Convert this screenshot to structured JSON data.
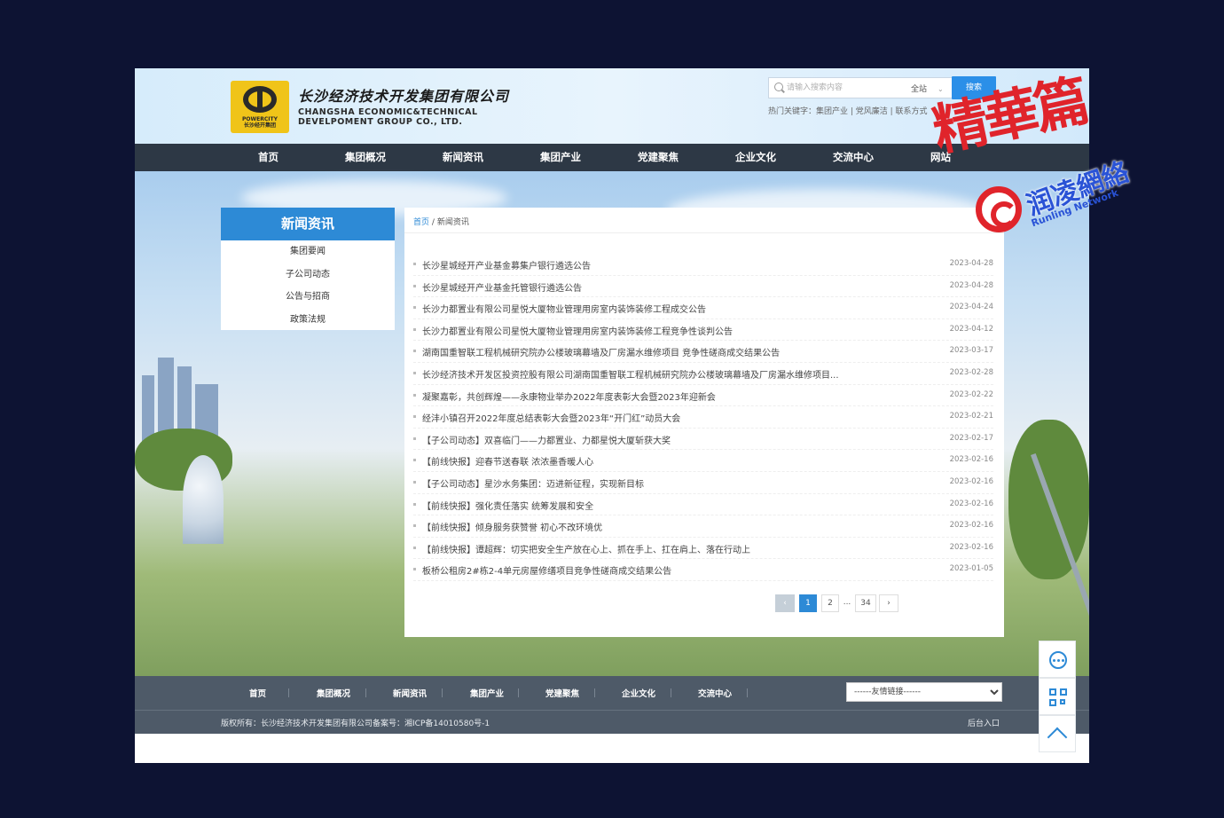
{
  "header": {
    "company_cn": "长沙经济技术开发集团有限公司",
    "company_en_line1": "CHANGSHA ECONOMIC&TECHNICAL",
    "company_en_line2": "DEVELPOMENT GROUP CO., LTD.",
    "logo_text_line1": "POWERCITY",
    "logo_text_line2": "长沙经开集团",
    "search": {
      "placeholder": "请输入搜索内容",
      "scope": "全站",
      "button": "搜索"
    },
    "hot_links": "热门关键字：集团产业 | 党风廉洁 | 联系方式"
  },
  "nav": [
    "首页",
    "集团概况",
    "新闻资讯",
    "集团产业",
    "党建聚焦",
    "企业文化",
    "交流中心",
    "网站"
  ],
  "sidebar": {
    "title": "新闻资讯",
    "items": [
      "集团要闻",
      "子公司动态",
      "公告与招商",
      "政策法规"
    ]
  },
  "breadcrumb": {
    "home": "首页",
    "separator": "/",
    "current": "新闻资讯"
  },
  "news": [
    {
      "title": "长沙星城经开产业基金募集户银行遴选公告",
      "date": "2023-04-28"
    },
    {
      "title": "长沙星城经开产业基金托管银行遴选公告",
      "date": "2023-04-28"
    },
    {
      "title": "长沙力都置业有限公司星悦大厦物业管理用房室内装饰装修工程成交公告",
      "date": "2023-04-24"
    },
    {
      "title": "长沙力都置业有限公司星悦大厦物业管理用房室内装饰装修工程竞争性谈判公告",
      "date": "2023-04-12"
    },
    {
      "title": "湖南国重智联工程机械研究院办公楼玻璃幕墙及厂房漏水维修项目 竞争性磋商成交结果公告",
      "date": "2023-03-17"
    },
    {
      "title": "长沙经济技术开发区投资控股有限公司湖南国重智联工程机械研究院办公楼玻璃幕墙及厂房漏水维修项目...",
      "date": "2023-02-28"
    },
    {
      "title": "凝聚嘉彰，共创辉煌——永康物业举办2022年度表彰大会暨2023年迎新会",
      "date": "2023-02-22"
    },
    {
      "title": "经沣小镇召开2022年度总结表彰大会暨2023年“开门红”动员大会",
      "date": "2023-02-21"
    },
    {
      "title": "【子公司动态】双喜临门——力都置业、力都星悦大厦斩获大奖",
      "date": "2023-02-17"
    },
    {
      "title": "【前线快报】迎春节送春联 浓浓墨香暖人心",
      "date": "2023-02-16"
    },
    {
      "title": "【子公司动态】星沙水务集团：迈进新征程，实现新目标",
      "date": "2023-02-16"
    },
    {
      "title": "【前线快报】强化责任落实 统筹发展和安全",
      "date": "2023-02-16"
    },
    {
      "title": "【前线快报】倾身服务获赞誉 初心不改环境优",
      "date": "2023-02-16"
    },
    {
      "title": "【前线快报】谭超辉：切实把安全生产放在心上、抓在手上、扛在肩上、落在行动上",
      "date": "2023-02-16"
    },
    {
      "title": "板桥公租房2#栋2-4单元房屋修缮项目竞争性磋商成交结果公告",
      "date": "2023-01-05"
    }
  ],
  "pager": {
    "prev": "‹",
    "pages": [
      "1",
      "2"
    ],
    "ellipsis": "...",
    "last": "34",
    "next": "›"
  },
  "footer": {
    "nav": [
      "首页",
      "集团概况",
      "新闻资讯",
      "集团产业",
      "党建聚焦",
      "企业文化",
      "交流中心"
    ],
    "friend_links": "------友情链接------",
    "copyright": "版权所有：长沙经济技术开发集团有限公司备案号：湘ICP备14010580号-1",
    "admin": "后台入口"
  },
  "watermark": {
    "big": "精華篇",
    "cn": "润凌網絡",
    "en": "Runling Network"
  },
  "colors": {
    "accent": "#2d8ad6",
    "nav_bg": "#2d3845",
    "footer_bg": "#4e5a68",
    "page_bg": "#0d1333",
    "watermark_red": "#e0242b"
  }
}
